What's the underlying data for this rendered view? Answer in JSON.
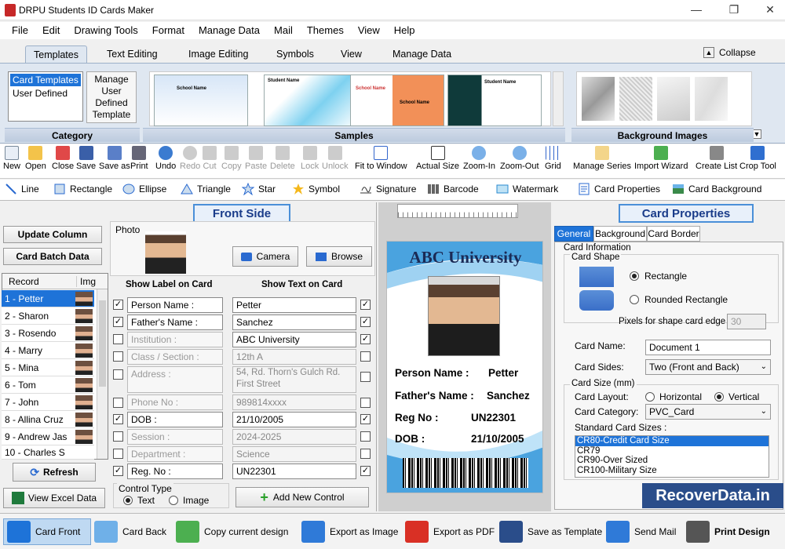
{
  "app": {
    "title": "DRPU Students ID Cards Maker"
  },
  "menu": [
    "File",
    "Edit",
    "Drawing Tools",
    "Format",
    "Manage Data",
    "Mail",
    "Themes",
    "View",
    "Help"
  ],
  "ribbon_tabs": [
    "Templates",
    "Text Editing",
    "Image Editing",
    "Symbols",
    "View",
    "Manage Data"
  ],
  "collapse_label": "Collapse",
  "category": {
    "items": [
      "Card Templates",
      "User Defined"
    ],
    "manage_label": "Manage User Defined Template",
    "group_label": "Category"
  },
  "samples": {
    "group_label": "Samples",
    "bg_label": "Background Images",
    "s1": "School Name",
    "s2": "School Name",
    "s3": "School Name",
    "s4": "School Name",
    "s5": "Student Name"
  },
  "toolbar": [
    "New",
    "Open",
    "Close",
    "Save",
    "Save as",
    "Print",
    "Undo",
    "Redo",
    "Cut",
    "Copy",
    "Paste",
    "Delete",
    "Lock",
    "Unlock",
    "Fit to Window",
    "Actual Size",
    "Zoom-In",
    "Zoom-Out",
    "Grid",
    "Manage Series",
    "Import Wizard",
    "Create List",
    "Crop Tool"
  ],
  "drawbar": [
    "Line",
    "Rectangle",
    "Ellipse",
    "Triangle",
    "Star",
    "Symbol",
    "Signature",
    "Barcode",
    "Watermark",
    "Card Properties",
    "Card Background"
  ],
  "front": {
    "title": "Front Side",
    "update_column": "Update Column",
    "card_batch": "Card Batch Data",
    "photo_label": "Photo",
    "camera": "Camera",
    "browse": "Browse",
    "show_label": "Show Label on Card",
    "show_text": "Show Text on Card",
    "refresh": "Refresh",
    "view_excel": "View Excel Data",
    "control_type": "Control Type",
    "text_opt": "Text",
    "image_opt": "Image",
    "add_control": "Add New Control"
  },
  "records": {
    "header_record": "Record",
    "header_img": "Img",
    "items": [
      "1 - Petter",
      "2 - Sharon",
      "3 - Rosendo",
      "4 - Marry",
      "5 - Mina",
      "6 - Tom",
      "7 - John",
      "8 - Allina Cruz",
      "9 - Andrew Jas",
      "10 - Charles S"
    ]
  },
  "fields": [
    {
      "label": "Person Name :",
      "value": "Petter",
      "on": true
    },
    {
      "label": "Father's Name :",
      "value": "Sanchez",
      "on": true
    },
    {
      "label": "Institution :",
      "value": "ABC University",
      "on": false
    },
    {
      "label": "Class / Section :",
      "value": "12th A",
      "on": false
    },
    {
      "label": "Address :",
      "value": "54, Rd. Thorn's Gulch Rd. First Street",
      "on": false
    },
    {
      "label": "Phone No :",
      "value": "989814xxxx",
      "on": false
    },
    {
      "label": "DOB :",
      "value": "21/10/2005",
      "on": true
    },
    {
      "label": "Session :",
      "value": "2024-2025",
      "on": false
    },
    {
      "label": "Department :",
      "value": "Science",
      "on": false
    },
    {
      "label": "Reg. No :",
      "value": "UN22301",
      "on": true
    }
  ],
  "card": {
    "university": "ABC University",
    "rows": [
      {
        "k": "Person Name :",
        "v": "Petter"
      },
      {
        "k": "Father's Name :",
        "v": "Sanchez"
      },
      {
        "k": "Reg No :",
        "v": "UN22301"
      },
      {
        "k": "DOB :",
        "v": "21/10/2005"
      }
    ]
  },
  "props": {
    "title": "Card Properties",
    "tabs": [
      "General",
      "Background",
      "Card Border"
    ],
    "card_info": "Card Information",
    "card_shape": "Card Shape",
    "rectangle": "Rectangle",
    "rounded": "Rounded Rectangle",
    "pixels_label": "Pixels for shape card edge :",
    "pixels_value": "30",
    "card_name_label": "Card Name:",
    "card_name": "Document 1",
    "card_sides_label": "Card Sides:",
    "card_sides": "Two (Front and Back)",
    "card_size": "Card Size (mm)",
    "card_layout": "Card Layout:",
    "horizontal": "Horizontal",
    "vertical": "Vertical",
    "card_category_label": "Card Category:",
    "card_category": "PVC_Card",
    "std_sizes": "Standard Card Sizes :",
    "sizes": [
      "CR80-Credit Card Size",
      "CR79",
      "CR90-Over Sized",
      "CR100-Military Size"
    ]
  },
  "watermark": "RecoverData.in",
  "bottom": [
    "Card Front",
    "Card Back",
    "Copy current design",
    "Export as Image",
    "Export as PDF",
    "Save as Template",
    "Send Mail",
    "Print Design"
  ]
}
